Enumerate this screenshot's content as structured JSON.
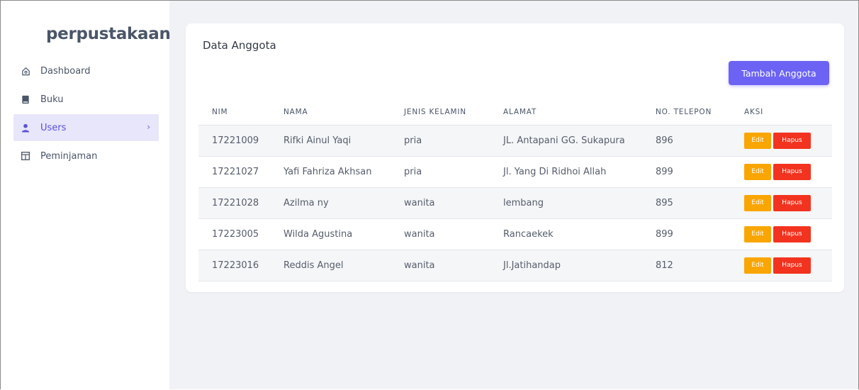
{
  "sidebar": {
    "brand": "perpustakaan",
    "items": [
      {
        "label": "Dashboard",
        "icon": "home-icon"
      },
      {
        "label": "Buku",
        "icon": "book-icon"
      },
      {
        "label": "Users",
        "icon": "user-icon",
        "active": true
      },
      {
        "label": "Peminjaman",
        "icon": "table-icon"
      }
    ]
  },
  "main": {
    "title": "Data Anggota",
    "add_button": "Tambah Anggota",
    "columns": [
      "NIM",
      "NAMA",
      "JENIS KELAMIN",
      "ALAMAT",
      "NO. TELEPON",
      "AKSI"
    ],
    "rows": [
      {
        "nim": "17221009",
        "nama": "Rifki Ainul Yaqi",
        "jk": "pria",
        "alamat": "JL. Antapani GG. Sukapura",
        "telp": "896"
      },
      {
        "nim": "17221027",
        "nama": "Yafi Fahriza Akhsan",
        "jk": "pria",
        "alamat": "Jl. Yang Di Ridhoi Allah",
        "telp": "899"
      },
      {
        "nim": "17221028",
        "nama": "Azilma ny",
        "jk": "wanita",
        "alamat": "lembang",
        "telp": "895"
      },
      {
        "nim": "17223005",
        "nama": "Wilda Agustina",
        "jk": "wanita",
        "alamat": "Rancaekek",
        "telp": "899"
      },
      {
        "nim": "17223016",
        "nama": "Reddis Angel",
        "jk": "wanita",
        "alamat": "Jl.Jatihandap",
        "telp": "812"
      }
    ],
    "edit_label": "Edit",
    "delete_label": "Hapus"
  },
  "colors": {
    "accent": "#6c63f5",
    "edit": "#f9a602",
    "delete": "#f2331f",
    "active_bg": "#e7e6fb"
  }
}
